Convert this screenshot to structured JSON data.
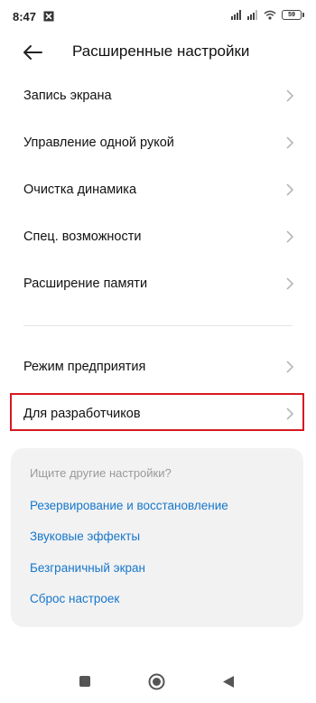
{
  "status_bar": {
    "time": "8:47",
    "battery": "59",
    "icons": [
      "notification-icon",
      "signal-icon",
      "signal-icon",
      "wifi-icon",
      "battery-icon"
    ]
  },
  "header": {
    "title": "Расширенные настройки",
    "back_icon": "back-arrow-icon"
  },
  "settings": {
    "items": [
      {
        "label": "Запись экрана"
      },
      {
        "label": "Управление одной рукой"
      },
      {
        "label": "Очистка динамика"
      },
      {
        "label": "Спец. возможности"
      },
      {
        "label": "Расширение памяти"
      },
      {
        "label": "Режим предприятия"
      },
      {
        "label": "Для разработчиков"
      }
    ],
    "highlighted_item": "Для разработчиков",
    "highlight_color": "#d71920"
  },
  "search_card": {
    "title": "Ищите другие настройки?",
    "links": [
      {
        "label": "Резервирование и восстановление"
      },
      {
        "label": "Звуковые эффекты"
      },
      {
        "label": "Безграничный экран"
      },
      {
        "label": "Сброс настроек"
      }
    ],
    "link_color": "#1677cc"
  },
  "nav_bar": {
    "buttons": [
      "recents-icon",
      "home-icon",
      "back-triangle-icon"
    ]
  }
}
